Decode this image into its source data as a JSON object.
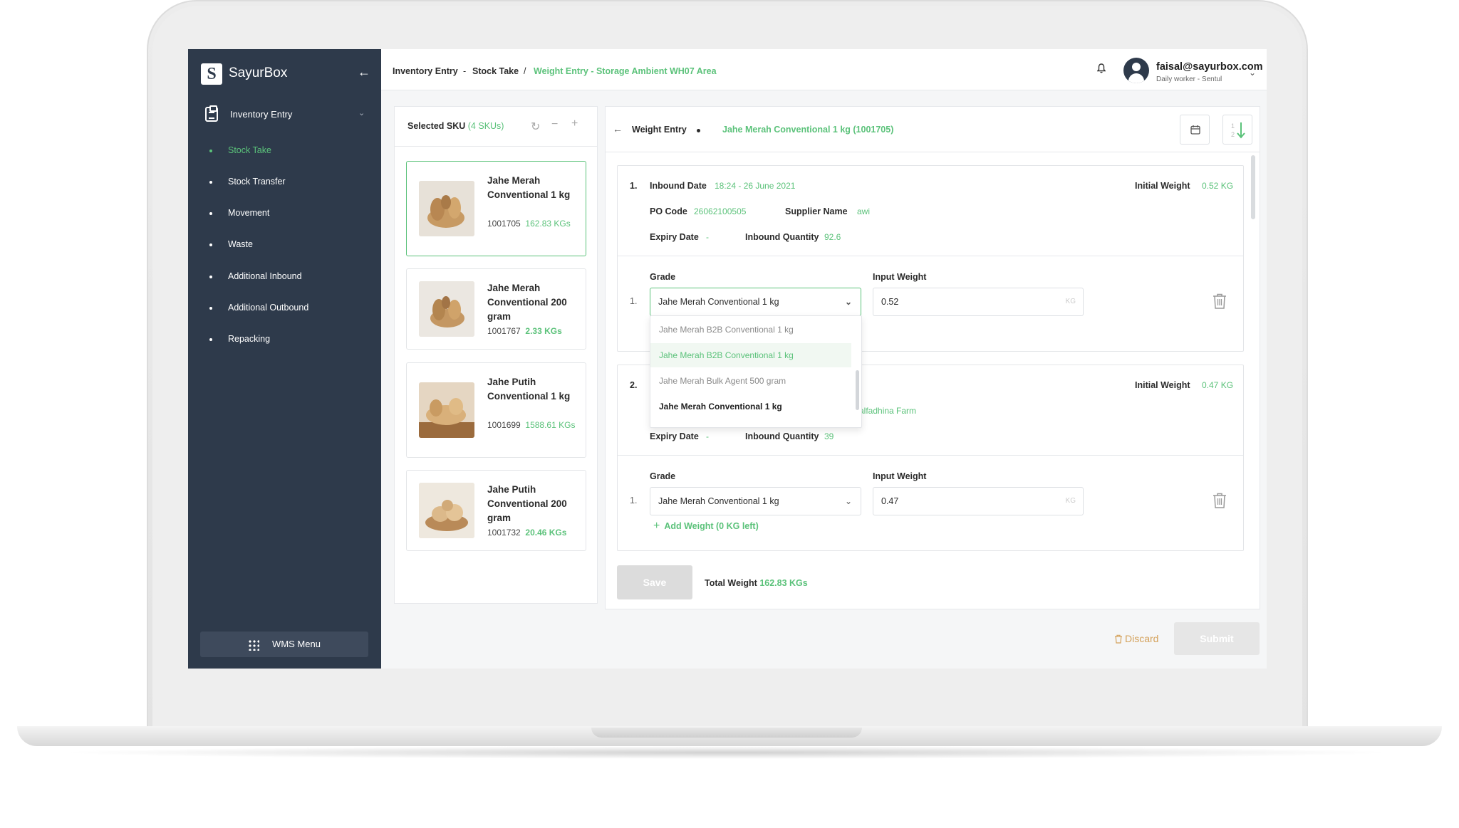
{
  "sidebar": {
    "logo_letter": "S",
    "brand": "SayurBox",
    "collapse_icon": "arrow-left-icon",
    "menu_header": "Inventory Entry",
    "items": [
      {
        "label": "Stock Take",
        "active": true
      },
      {
        "label": "Stock Transfer",
        "active": false
      },
      {
        "label": "Movement",
        "active": false
      },
      {
        "label": "Waste",
        "active": false
      },
      {
        "label": "Additional Inbound",
        "active": false
      },
      {
        "label": "Additional Outbound",
        "active": false
      },
      {
        "label": "Repacking",
        "active": false
      }
    ],
    "wms_menu": "WMS Menu"
  },
  "breadcrumb": {
    "part1": "Inventory Entry",
    "sep1": "-",
    "part2": "Stock Take",
    "sep2": "/",
    "current": "Weight Entry - Storage Ambient WH07 Area"
  },
  "user": {
    "email": "faisal@sayurbox.com",
    "role": "Daily worker - Sentul"
  },
  "sku_panel": {
    "title": "Selected SKU",
    "count": "(4 SKUs)",
    "items": [
      {
        "name": "Jahe Merah Conventional 1 kg",
        "code": "1001705",
        "qty": "162.83 KGs",
        "selected": true
      },
      {
        "name": "Jahe Merah Conventional 200 gram",
        "code": "1001767",
        "qty": "2.33 KGs",
        "selected": false
      },
      {
        "name": "Jahe Putih Conventional 1 kg",
        "code": "1001699",
        "qty": "1588.61 KGs",
        "selected": false
      },
      {
        "name": "Jahe Putih Conventional 200 gram",
        "code": "1001732",
        "qty": "20.46 KGs",
        "selected": false
      }
    ]
  },
  "weight_entry": {
    "title": "Weight Entry",
    "sku": "Jahe Merah Conventional 1 kg (1001705)",
    "labels": {
      "inbound_date": "Inbound Date",
      "initial_weight": "Initial Weight",
      "po_code": "PO Code",
      "supplier_name": "Supplier Name",
      "expiry_date": "Expiry Date",
      "inbound_quantity": "Inbound Quantity",
      "grade": "Grade",
      "input_weight": "Input Weight",
      "unit": "KG"
    },
    "entries": [
      {
        "index": "1.",
        "inbound_date": "18:24 - 26 June 2021",
        "initial_weight": "0.52 KG",
        "po_code": "26062100505",
        "supplier": "awi",
        "expiry": "-",
        "inbound_qty": "92.6",
        "grade_index": "1.",
        "grade": "Jahe Merah Conventional 1 kg",
        "weight": "0.52"
      },
      {
        "index": "2.",
        "initial_weight": "0.47 KG",
        "supplier_partial": "alfadhina Farm",
        "expiry": "-",
        "inbound_qty": "39",
        "grade_index": "1.",
        "grade": "Jahe Merah Conventional 1 kg",
        "weight": "0.47",
        "add_weight": "Add Weight (0 KG left)"
      }
    ],
    "dropdown_options": [
      "Jahe Merah B2B Conventional 1 kg",
      "Jahe Merah B2B Conventional 1 kg",
      "Jahe Merah Bulk Agent 500 gram",
      "Jahe Merah Conventional 1 kg"
    ],
    "save": "Save",
    "total_label": "Total Weight",
    "total_value": "162.83 KGs"
  },
  "footer": {
    "discard": "Discard",
    "submit": "Submit"
  },
  "colors": {
    "accent": "#5bc27a",
    "sidebar": "#2e3a4b",
    "discard": "#d4a15a"
  }
}
